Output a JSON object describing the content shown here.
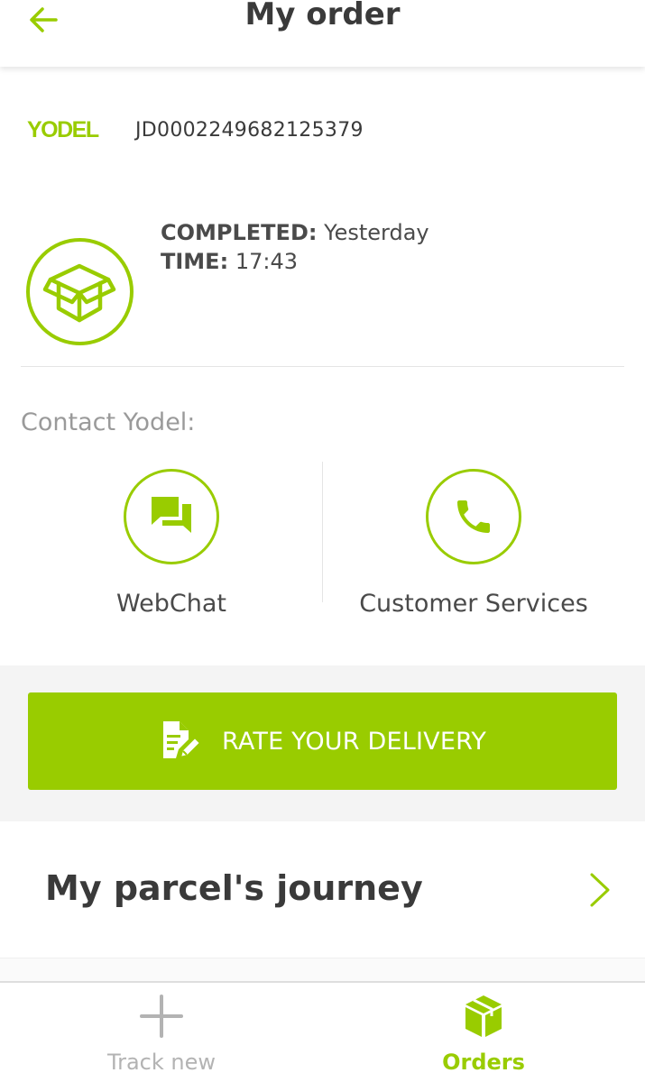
{
  "header": {
    "title": "My order"
  },
  "order": {
    "carrier_logo": "YODEL",
    "tracking_number": "JD0002249682125379",
    "status_label": "COMPLETED:",
    "status_value": "Yesterday",
    "time_label": "TIME:",
    "time_value": "17:43"
  },
  "contact": {
    "title": "Contact Yodel:",
    "options": [
      {
        "label": "WebChat",
        "icon": "chat-icon"
      },
      {
        "label": "Customer Services",
        "icon": "phone-icon"
      }
    ]
  },
  "rate": {
    "label": "RATE YOUR DELIVERY",
    "icon": "rate-edit-icon"
  },
  "journey": {
    "title": "My parcel's journey"
  },
  "bottom_nav": {
    "items": [
      {
        "label": "Track new",
        "icon": "plus-icon",
        "active": false
      },
      {
        "label": "Orders",
        "icon": "parcel-icon",
        "active": true
      }
    ]
  },
  "colors": {
    "accent": "#99cc00",
    "text_dark": "#3a3a3a",
    "text_muted": "#9a9a9a",
    "band_bg": "#f4f4f4"
  }
}
